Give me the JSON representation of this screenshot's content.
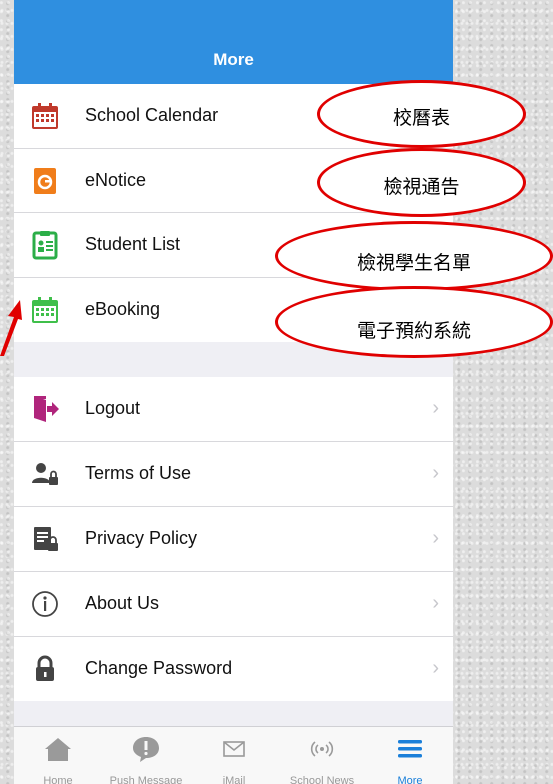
{
  "header": {
    "title": "More"
  },
  "menu_top": [
    {
      "label": "School Calendar",
      "icon": "calendar-icon"
    },
    {
      "label": "eNotice",
      "icon": "enotice-icon"
    },
    {
      "label": "Student List",
      "icon": "student-list-icon"
    },
    {
      "label": "eBooking",
      "icon": "ebooking-icon"
    }
  ],
  "menu_bottom": [
    {
      "label": "Logout",
      "icon": "logout-icon"
    },
    {
      "label": "Terms of Use",
      "icon": "terms-icon"
    },
    {
      "label": "Privacy Policy",
      "icon": "privacy-icon"
    },
    {
      "label": "About Us",
      "icon": "info-icon"
    },
    {
      "label": "Change Password",
      "icon": "lock-icon"
    }
  ],
  "chevron": "›",
  "tabs": [
    {
      "label": "Home",
      "icon": "home-icon"
    },
    {
      "label": "Push Message",
      "icon": "push-message-icon"
    },
    {
      "label": "iMail",
      "icon": "mail-icon"
    },
    {
      "label": "School News",
      "icon": "broadcast-icon"
    },
    {
      "label": "More",
      "icon": "menu-icon"
    }
  ],
  "annotations": [
    "校曆表",
    "檢視通告",
    "檢視學生名單",
    "電子預約系統"
  ],
  "colors": {
    "header": "#2f8fe0",
    "annotation": "#e00000",
    "active_tab": "#1a7fd9"
  }
}
